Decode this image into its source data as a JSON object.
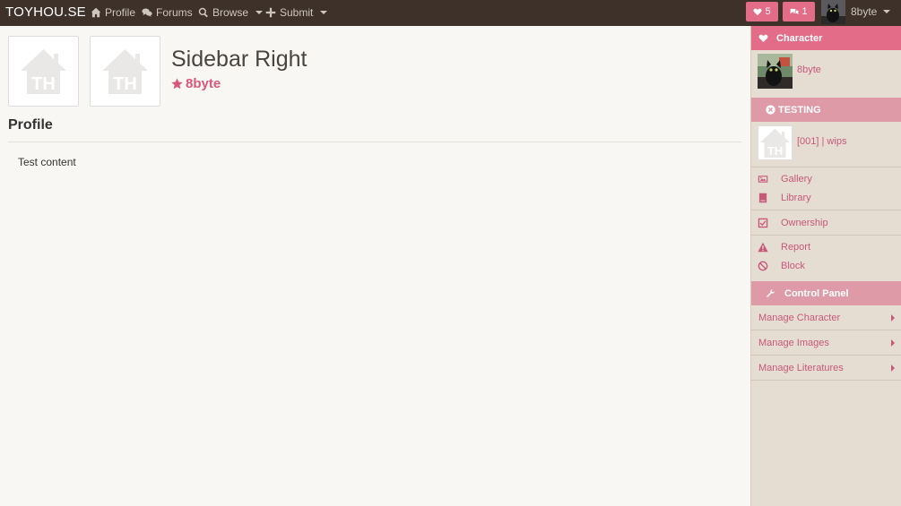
{
  "navbar": {
    "brand": "TOYHOU.SE",
    "profile": "Profile",
    "forums": "Forums",
    "browse": "Browse",
    "submit": "Submit",
    "favorites_count": "5",
    "notifications_count": "1",
    "username": "8byte"
  },
  "main": {
    "title": "Sidebar Right",
    "owner": "8byte",
    "section_heading": "Profile",
    "content_text": "Test content"
  },
  "sidebar": {
    "character_header": "Character",
    "character_owner": "8byte",
    "testing_header": "TESTING",
    "testing_link": "[001] | wips",
    "links": {
      "gallery": "Gallery",
      "library": "Library",
      "ownership": "Ownership",
      "report": "Report",
      "block": "Block"
    },
    "control_panel_header": "Control Panel",
    "menu": {
      "manage_character": "Manage Character",
      "manage_images": "Manage Images",
      "manage_literatures": "Manage Literatures"
    }
  },
  "colors": {
    "navbar_bg": "#3d3129",
    "accent": "#e36d88",
    "link": "#c7587a",
    "sidebar_bg": "#e5ddd2"
  }
}
